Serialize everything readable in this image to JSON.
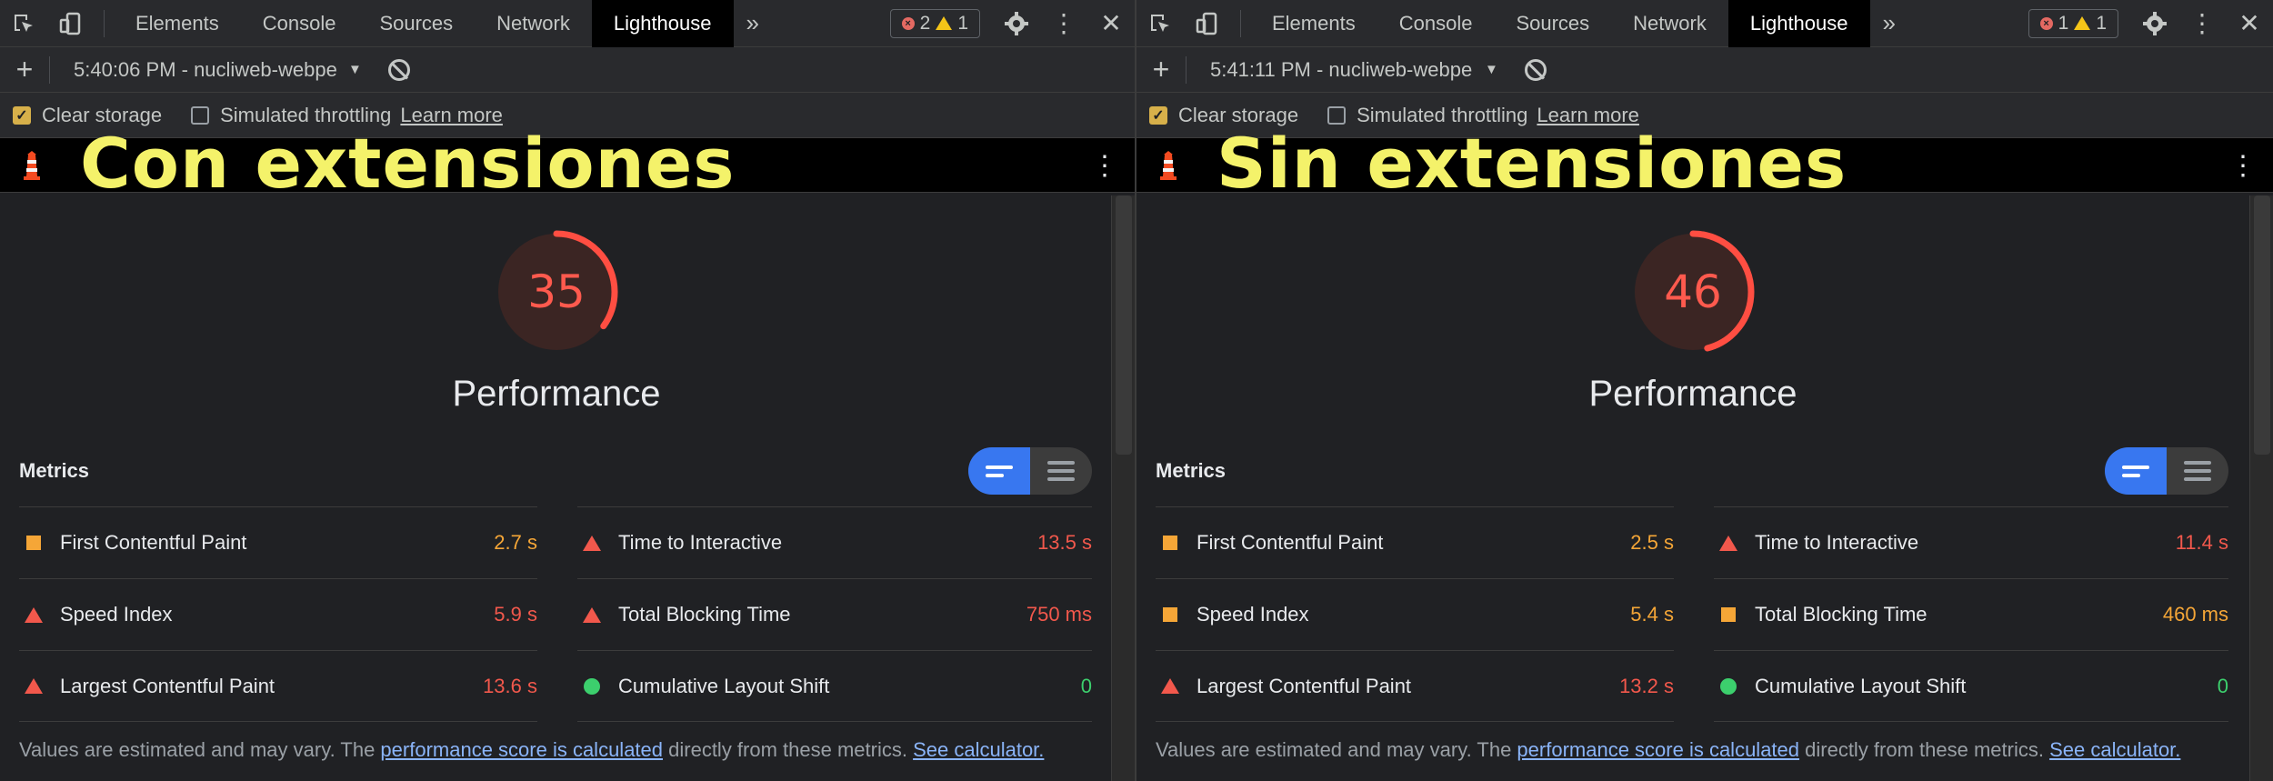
{
  "tabs": [
    "Elements",
    "Console",
    "Sources",
    "Network",
    "Lighthouse"
  ],
  "panels": [
    {
      "issues": {
        "errors": "2",
        "warnings": "1"
      },
      "report_name": "5:40:06 PM - nucliweb-webpe",
      "settings": {
        "clear_storage": "Clear storage",
        "throttling": "Simulated throttling",
        "learn_more": "Learn more"
      },
      "overlay_title": "Con extensiones",
      "score": "35",
      "score_fraction": 0.35,
      "category": "Performance",
      "metrics_label": "Metrics",
      "metrics_left": [
        {
          "name": "First Contentful Paint",
          "value": "2.7 s",
          "icon": "average-square",
          "color": "orange"
        },
        {
          "name": "Speed Index",
          "value": "5.9 s",
          "icon": "fail-triangle",
          "color": "red"
        },
        {
          "name": "Largest Contentful Paint",
          "value": "13.6 s",
          "icon": "fail-triangle",
          "color": "red"
        }
      ],
      "metrics_right": [
        {
          "name": "Time to Interactive",
          "value": "13.5 s",
          "icon": "fail-triangle",
          "color": "red"
        },
        {
          "name": "Total Blocking Time",
          "value": "750 ms",
          "icon": "fail-triangle",
          "color": "red"
        },
        {
          "name": "Cumulative Layout Shift",
          "value": "0",
          "icon": "pass-circle",
          "color": "green"
        }
      ],
      "footnote": {
        "prefix": "Values are estimated and may vary. The ",
        "link1": "performance score is calculated",
        "middle": " directly from these metrics. ",
        "link2": "See calculator."
      }
    },
    {
      "issues": {
        "errors": "1",
        "warnings": "1"
      },
      "report_name": "5:41:11 PM - nucliweb-webpe",
      "settings": {
        "clear_storage": "Clear storage",
        "throttling": "Simulated throttling",
        "learn_more": "Learn more"
      },
      "overlay_title": "Sin extensiones",
      "score": "46",
      "score_fraction": 0.46,
      "category": "Performance",
      "metrics_label": "Metrics",
      "metrics_left": [
        {
          "name": "First Contentful Paint",
          "value": "2.5 s",
          "icon": "average-square",
          "color": "orange"
        },
        {
          "name": "Speed Index",
          "value": "5.4 s",
          "icon": "average-square",
          "color": "orange"
        },
        {
          "name": "Largest Contentful Paint",
          "value": "13.2 s",
          "icon": "fail-triangle",
          "color": "red"
        }
      ],
      "metrics_right": [
        {
          "name": "Time to Interactive",
          "value": "11.4 s",
          "icon": "fail-triangle",
          "color": "red"
        },
        {
          "name": "Total Blocking Time",
          "value": "460 ms",
          "icon": "average-square",
          "color": "orange"
        },
        {
          "name": "Cumulative Layout Shift",
          "value": "0",
          "icon": "pass-circle",
          "color": "green"
        }
      ],
      "footnote": {
        "prefix": "Values are estimated and may vary. The ",
        "link1": "performance score is calculated",
        "middle": " directly from these metrics. ",
        "link2": "See calculator."
      }
    }
  ],
  "colors": {
    "fail": "#f2584c",
    "average": "#f5a637",
    "pass": "#3ccf6d",
    "toggle_on": "#3877f0",
    "overlay_text": "#f4f26a"
  }
}
